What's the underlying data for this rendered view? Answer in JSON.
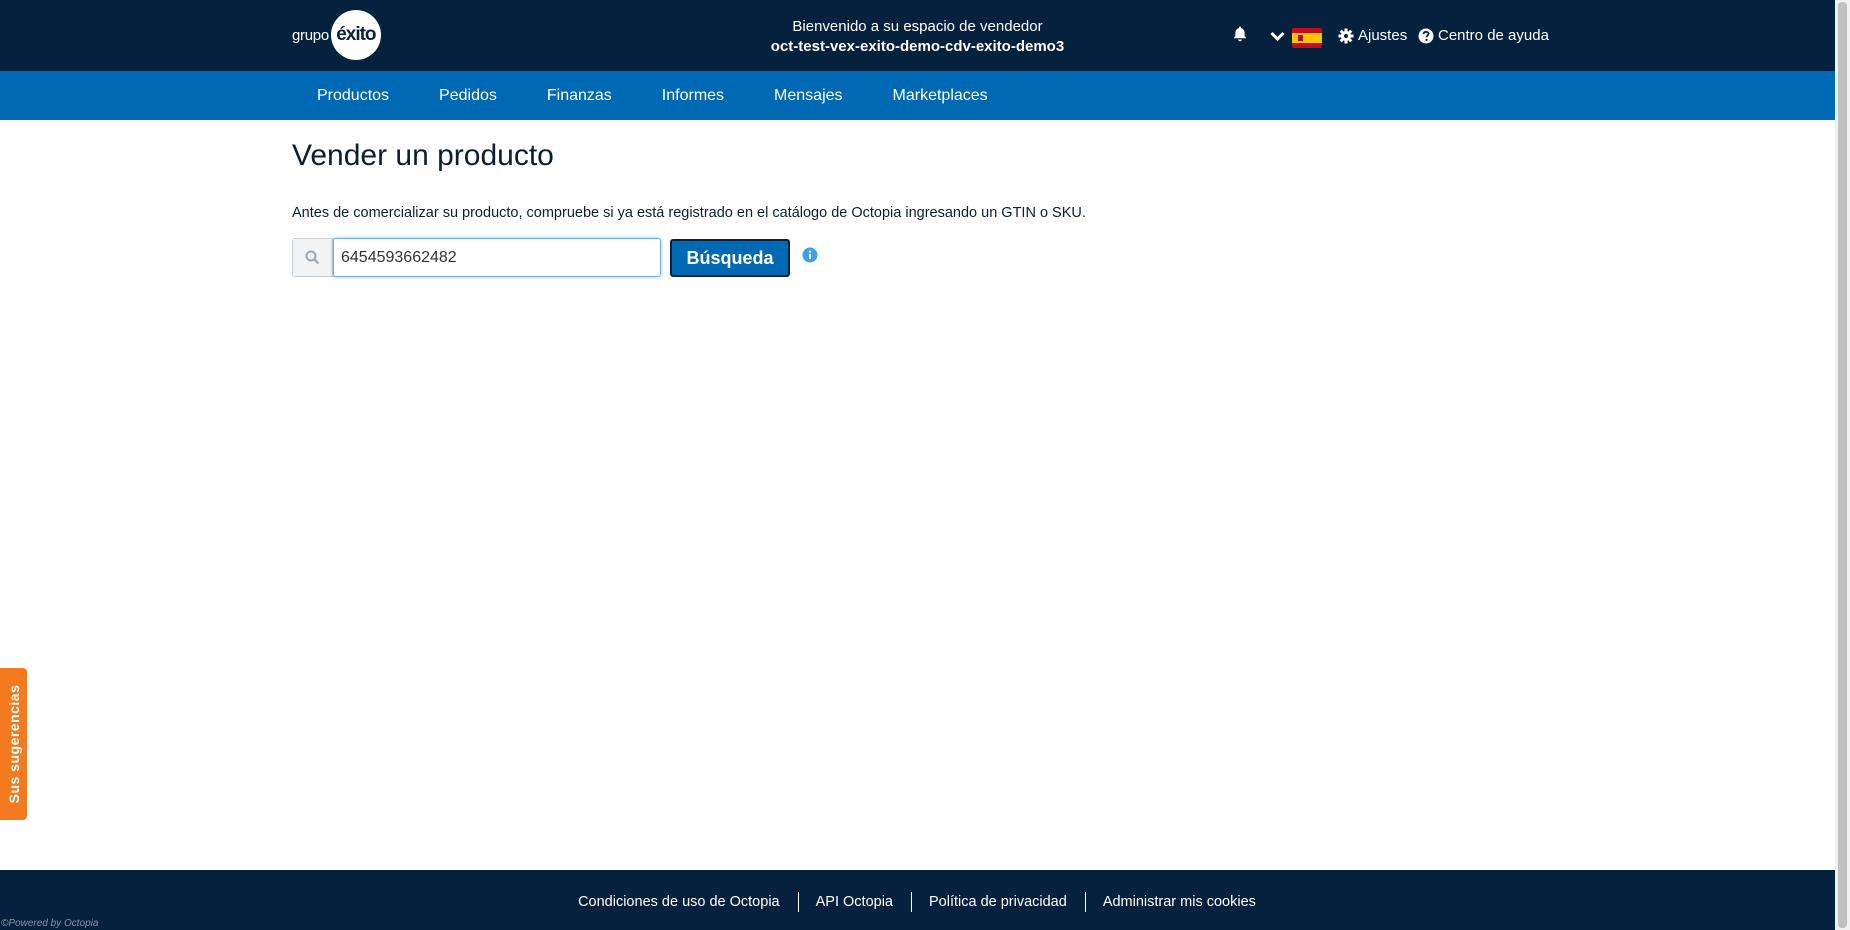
{
  "header": {
    "logo_grupo": "grupo",
    "logo_exito": "éxito",
    "welcome_line": "Bienvenido a su espacio de vendedor",
    "shop_name": "oct-test-vex-exito-demo-cdv-exito-demo3",
    "settings_label": "Ajustes",
    "help_label": "Centro de ayuda",
    "icons": [
      "bell-icon",
      "chevron-down-icon",
      "spain-flag-icon",
      "gear-icon",
      "question-circle-icon"
    ]
  },
  "nav": {
    "items": [
      {
        "label": "Productos"
      },
      {
        "label": "Pedidos"
      },
      {
        "label": "Finanzas"
      },
      {
        "label": "Informes"
      },
      {
        "label": "Mensajes"
      },
      {
        "label": "Marketplaces"
      }
    ]
  },
  "main": {
    "title": "Vender un producto",
    "intro": "Antes de comercializar su producto, compruebe si ya está registrado en el catálogo de Octopia ingresando un GTIN o SKU.",
    "search_value": "6454593662482",
    "search_button": "Búsqueda"
  },
  "feedback_tab": "Sus sugerencias",
  "footer": {
    "links": [
      {
        "label": "Condiciones de uso de Octopia"
      },
      {
        "label": "API Octopia"
      },
      {
        "label": "Política de privacidad"
      },
      {
        "label": "Administrar mis cookies"
      }
    ],
    "powered_by": "©Powered by Octopia"
  },
  "colors": {
    "header_bg": "#05213d",
    "nav_bg": "#0069b4",
    "accent_orange": "#f47a1f",
    "info_blue": "#3aa3e3"
  }
}
